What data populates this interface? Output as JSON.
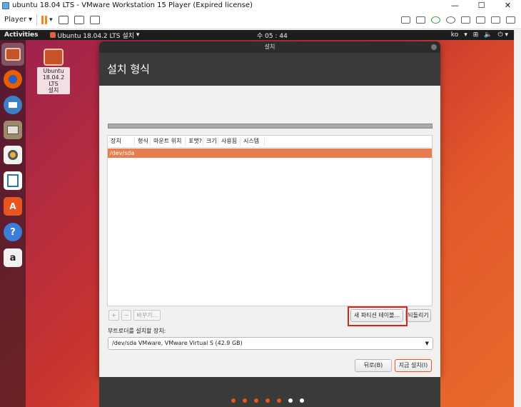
{
  "window": {
    "title": "ubuntu 18.04 LTS - VMware Workstation 15 Player (Expired license)",
    "minimize": "—",
    "maximize": "☐",
    "close": "✕"
  },
  "vm_toolbar": {
    "player_label": "Player",
    "player_caret": "▾",
    "pause_caret": "▾"
  },
  "topbar": {
    "activities": "Activities",
    "app_menu": "Ubuntu 18.04.2 LTS 설치",
    "app_caret": "▾",
    "clock": "수 05 : 44",
    "lang": "ko",
    "lang_caret": "▾",
    "tray": "⏻ ▾"
  },
  "dock": {
    "items": [
      {
        "name": "ubiquity",
        "color": "#c7522c"
      },
      {
        "name": "firefox",
        "color": "#e66000"
      },
      {
        "name": "thunderbird",
        "color": "#3d7fc4"
      },
      {
        "name": "files",
        "color": "#9c8a6a"
      },
      {
        "name": "rhythmbox",
        "color": "#e8b33a"
      },
      {
        "name": "libreoffice-writer",
        "color": "#2f6fb4"
      },
      {
        "name": "software",
        "color": "#e95420"
      },
      {
        "name": "help",
        "color": "#3b7dd8"
      },
      {
        "name": "amazon",
        "color": "#f2f2f2"
      }
    ],
    "help_glyph": "?",
    "amazon_glyph": "a"
  },
  "desktop_icon": {
    "label_line1": "Ubuntu",
    "label_line2": "18.04.2 LTS",
    "label_line3": "설치"
  },
  "installer": {
    "window_title": "설치",
    "heading": "설치 형식",
    "table_headers": [
      "장치",
      "형식",
      "마운트 위치",
      "포맷?",
      "크기",
      "사용됨",
      "시스템"
    ],
    "rows": [
      "/dev/sda"
    ],
    "add_btn": "+",
    "remove_btn": "−",
    "change_btn": "바꾸기...",
    "new_table_btn": "새 파티션 테이블...",
    "revert_btn": "되돌리기",
    "boot_label": "부트로더를 설치할 장치:",
    "boot_device": "/dev/sda VMware, VMware Virtual S (42.9 GB)",
    "back_btn": "뒤로(B)",
    "install_btn": "지금 설치(I)"
  },
  "progress_dots": {
    "total": 7,
    "done": 5,
    "done_color": "#e95420",
    "todo_color": "#ffffff"
  }
}
